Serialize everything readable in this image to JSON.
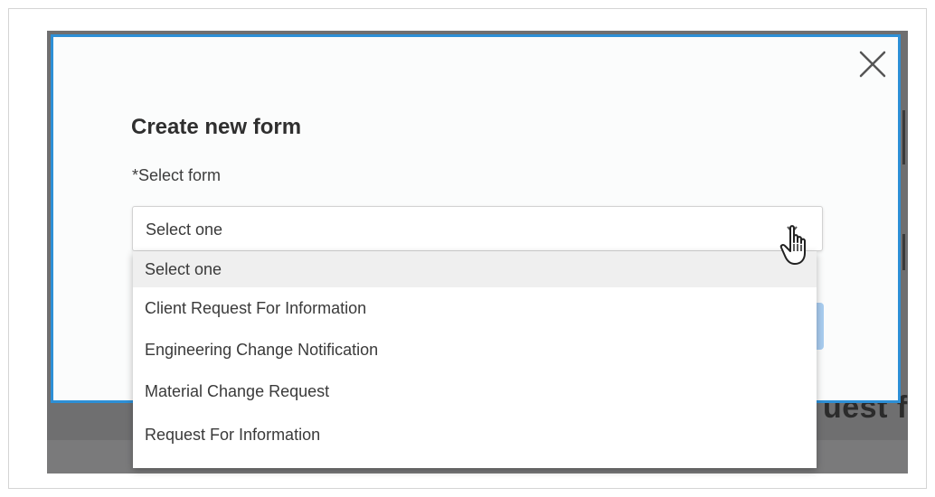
{
  "background": {
    "title_fragment": "uest f"
  },
  "modal": {
    "title": "Create new form",
    "field_label": "*Select form",
    "close_icon": "close-icon",
    "accent_color": "#2d8fd6"
  },
  "select": {
    "value": "Select one",
    "icon": "chevron-down-icon"
  },
  "dropdown": {
    "options": [
      "Select one",
      "Client Request For Information",
      "Engineering Change Notification",
      "Material Change Request",
      "Request For Information"
    ],
    "highlighted_index": 0
  },
  "pointer": {
    "icon": "hand-pointer-icon"
  }
}
